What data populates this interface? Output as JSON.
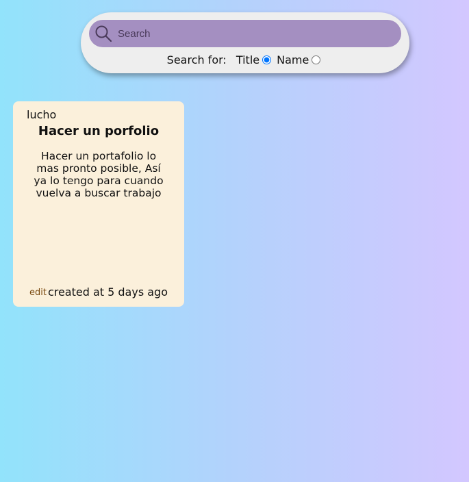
{
  "search": {
    "placeholder": "Search",
    "value": "",
    "search_for_label": "Search for:",
    "options": [
      {
        "label": "Title",
        "selected": true
      },
      {
        "label": "Name",
        "selected": false
      }
    ]
  },
  "icons": {
    "search": "search-icon"
  },
  "colors": {
    "search_bar": "#a48fc1",
    "card_background": "#fbf0db",
    "edit_link": "#7a4a10"
  },
  "cards": [
    {
      "author": "lucho",
      "title": "Hacer un porfolio",
      "body": "Hacer un portafolio lo mas pronto posible, Así ya lo tengo para cuando vuelva a buscar trabajo",
      "edit_label": "edit",
      "created": "created at 5 days ago"
    }
  ]
}
